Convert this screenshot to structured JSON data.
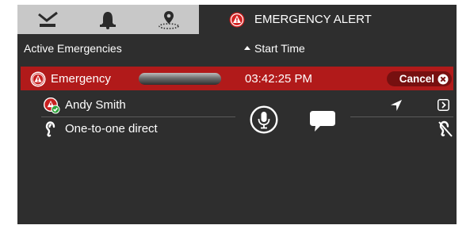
{
  "tabs": {
    "active_title": "EMERGENCY ALERT",
    "icons": [
      "checklist-icon",
      "bell-icon",
      "location-pin-icon"
    ]
  },
  "header": {
    "left_label": "Active Emergencies",
    "sort_label": "Start Time"
  },
  "emergency": {
    "label": "Emergency",
    "time": "03:42:25 PM",
    "cancel_label": "Cancel"
  },
  "person": {
    "name": "Andy Smith"
  },
  "call": {
    "mode": "One-to-one direct"
  },
  "colors": {
    "panel_bg": "#2e2e2e",
    "emergency_red": "#b11a1a",
    "tab_inactive": "#c8c8c8"
  }
}
